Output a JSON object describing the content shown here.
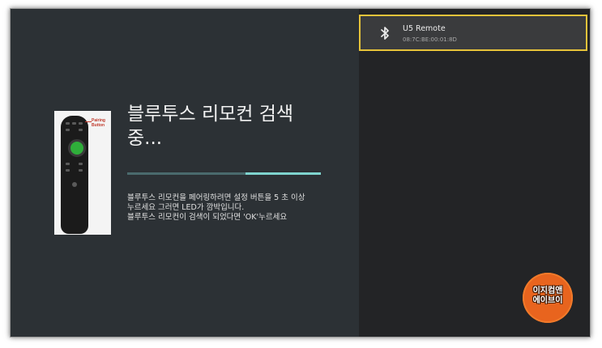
{
  "scan": {
    "title_line1": "블루투스 리모컨 검색",
    "title_line2": "중...",
    "progress_fraction": 0.39,
    "instructions": [
      "블루투스 리모컨을 페어링하려면 설정 버튼을 5 초 이상",
      "누르세요 그러면 LED가 깜박입니다.",
      "블루투스 리모컨이 검색이 되었다면 'OK'누르세요"
    ]
  },
  "remote_image": {
    "label_line1": "Pairing",
    "label_line2": "Button"
  },
  "devices": [
    {
      "icon": "bluetooth-icon",
      "name": "U5 Remote",
      "address": "08:7C:BE:00:01:8D"
    }
  ],
  "watermark": {
    "line1": "이지컴앤",
    "line2": "에이브이"
  },
  "colors": {
    "accent_focus": "#e6c33a",
    "progress_fill": "#7fd4cf",
    "watermark": "#e8641e"
  }
}
